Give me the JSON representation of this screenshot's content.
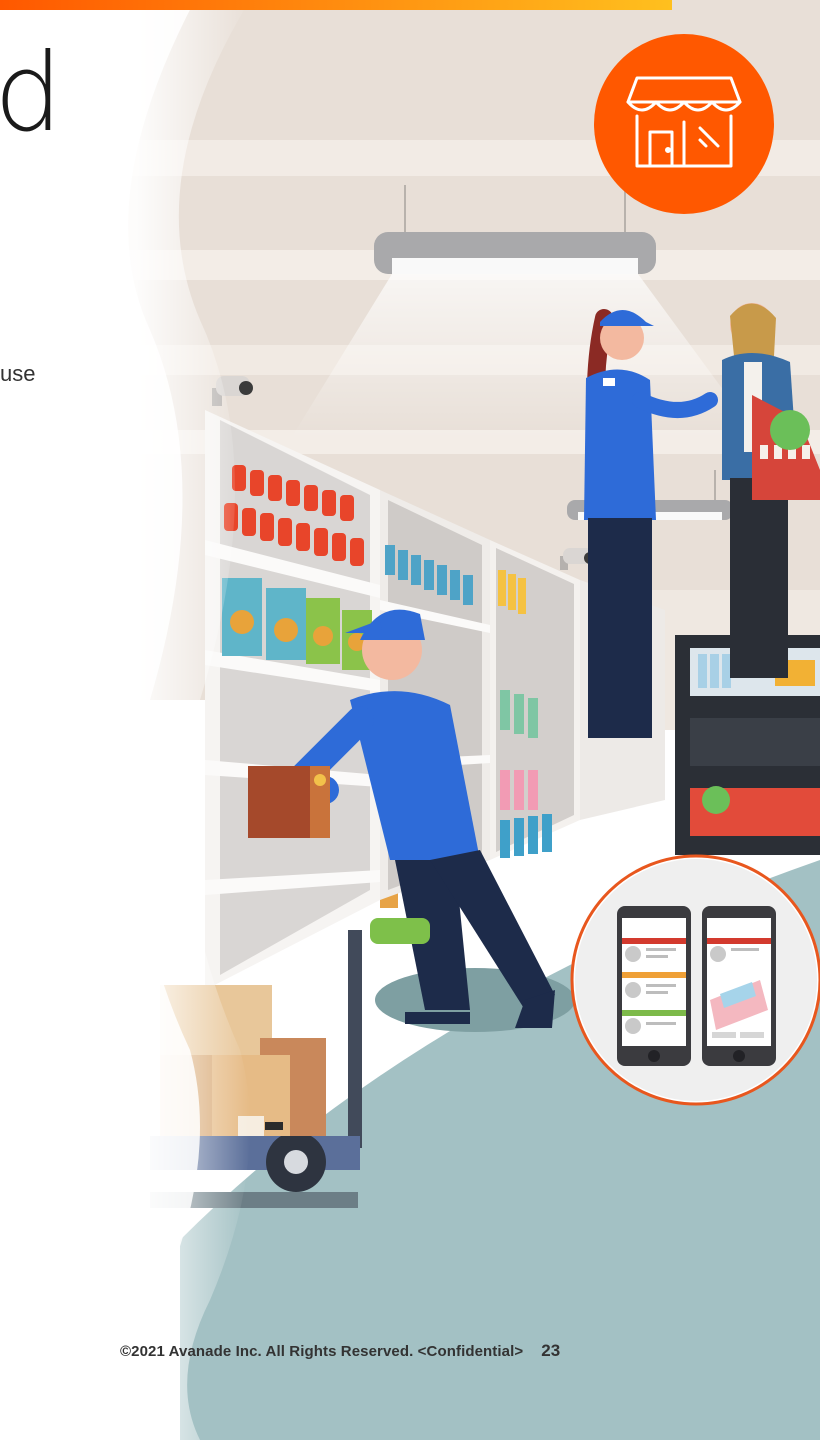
{
  "fragments": {
    "title_letter": "d",
    "body_fragment": "use"
  },
  "icons": {
    "store_badge": "storefront-icon"
  },
  "footer": {
    "copyright": "©2021 Avanade Inc. All Rights Reserved. <Confidential>",
    "page_number": "23"
  },
  "colors": {
    "accent_orange": "#FF5800",
    "accent_yellow": "#FFB81C",
    "uniform_blue": "#2E6BD8",
    "floor_teal": "#A3C1C4",
    "ceiling": "#E7DED6"
  }
}
